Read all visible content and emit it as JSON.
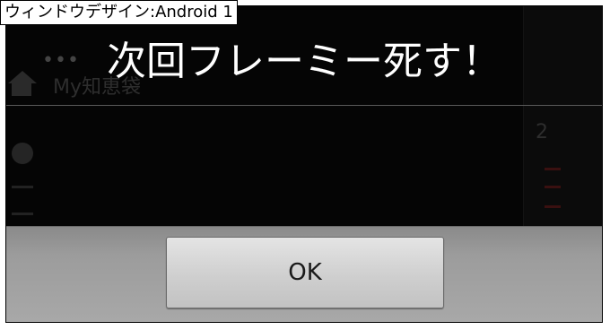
{
  "window": {
    "label": "ウィンドウデザイン:Android 1"
  },
  "background_app": {
    "overflow_menu": "•••",
    "title": "My知恵袋",
    "home_icon": "home-icon",
    "settings_icon": "gear-icon",
    "trophy_text": "2"
  },
  "dialog": {
    "title": "次回フレーミー死す！",
    "ok_label": "OK"
  },
  "colors": {
    "dialog_background": "#000000",
    "title_text": "#ffffff",
    "button_bar": "#9c9c9c",
    "button_face": "#d4d4d4"
  }
}
